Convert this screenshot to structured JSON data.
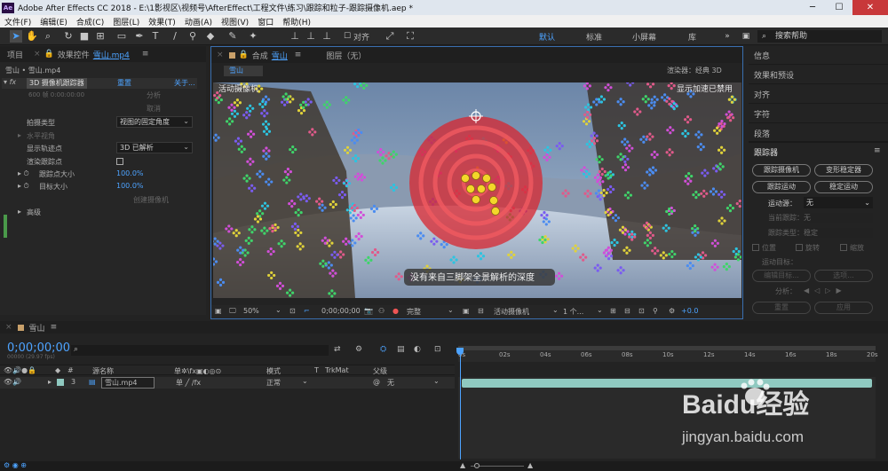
{
  "app": {
    "logo": "Ae",
    "title": "Adobe After Effects CC 2018 - E:\\1影视区\\视频号\\AfterEffect\\工程文件\\练习\\跟踪和粒子-跟踪摄像机.aep *"
  },
  "menu": [
    "文件(F)",
    "编辑(E)",
    "合成(C)",
    "图层(L)",
    "效果(T)",
    "动画(A)",
    "视图(V)",
    "窗口",
    "帮助(H)"
  ],
  "toolbar": {
    "snap_label": "对齐",
    "workspaces": [
      "默认",
      "标准",
      "小屏幕",
      "库"
    ],
    "search_placeholder": "搜索帮助"
  },
  "left_panel": {
    "tab_project": "项目",
    "tab_effects": "效果控件",
    "tab_effects_file": "雪山.mp4",
    "breadcrumb": "雪山 • 雪山.mp4",
    "effect_name": "3D 摄像机跟踪器",
    "effect_reset": "重置",
    "effect_about": "关于...",
    "analyze_btn": "分析",
    "cancel_btn": "取消",
    "time_status": "600 帧 0:00:00:00",
    "shot_type_label": "拍摄类型",
    "shot_type_value": "视图的固定角度",
    "fov_label": "水平视角",
    "show_track_label": "显示轨迹点",
    "show_track_value": "3D 已解析",
    "render_track_label": "渲染跟踪点",
    "track_size_label": "跟踪点大小",
    "track_size_value": "100.0%",
    "target_size_label": "目标大小",
    "target_size_value": "100.0%",
    "create_camera_btn": "创建摄像机",
    "advanced_label": "高级"
  },
  "comp_panel": {
    "tab_comp": "合成",
    "tab_comp_name": "雪山",
    "tab_layer": "图层（无）",
    "comp_chip": "雪山",
    "renderer": "渲染器：经典 3D",
    "viewer_top_left": "活动摄像机",
    "viewer_top_right": "显示加速已禁用",
    "subtitle": "没有来自三脚架全景解析的深度",
    "zoom": "50%",
    "timecode": "0;00;00;00",
    "resolution": "完整",
    "view": "活动摄像机",
    "views_count": "1 个...",
    "exposure": "+0.0"
  },
  "right_panel": {
    "sections": [
      "信息",
      "效果和预设",
      "对齐",
      "字符",
      "段落"
    ],
    "tracker_title": "跟踪器",
    "btn_track_camera": "跟踪摄像机",
    "btn_warp_stab": "变形稳定器",
    "btn_track_motion": "跟踪运动",
    "btn_stabilize": "稳定运动",
    "motion_source_label": "运动源：",
    "motion_source_value": "无",
    "current_track_label": "当前跟踪：",
    "current_track_value": "无",
    "track_type_label": "跟踪类型：",
    "track_type_value": "稳定",
    "chk_position": "位置",
    "chk_rotation": "旋转",
    "chk_scale": "缩放",
    "motion_target_label": "运动目标：",
    "edit_target_btn": "编辑目标...",
    "options_btn": "选项...",
    "analyze_label": "分析：",
    "reset_btn": "重置",
    "apply_btn": "应用"
  },
  "timeline": {
    "comp_tab": "雪山",
    "timecode": "0;00;00;00",
    "frames_info": "00000 (29.97 fps)",
    "columns": {
      "source": "源名称",
      "mode": "模式",
      "t": "T",
      "trkmat": "TrkMat",
      "parent": "父级"
    },
    "ruler_ticks": [
      "0s",
      "02s",
      "04s",
      "06s",
      "08s",
      "10s",
      "12s",
      "14s",
      "16s",
      "18s",
      "20s"
    ],
    "layer": {
      "index": "3",
      "name": "雪山.mp4",
      "mode": "正常",
      "parent": "无"
    }
  },
  "watermark": {
    "brand": "Baidu经验",
    "url": "jingyan.baidu.com"
  },
  "colors": {
    "accent": "#4da3ff",
    "panel_bg": "#232323",
    "target_red": "#d8252f",
    "track_bar": "#8fc9c0"
  }
}
